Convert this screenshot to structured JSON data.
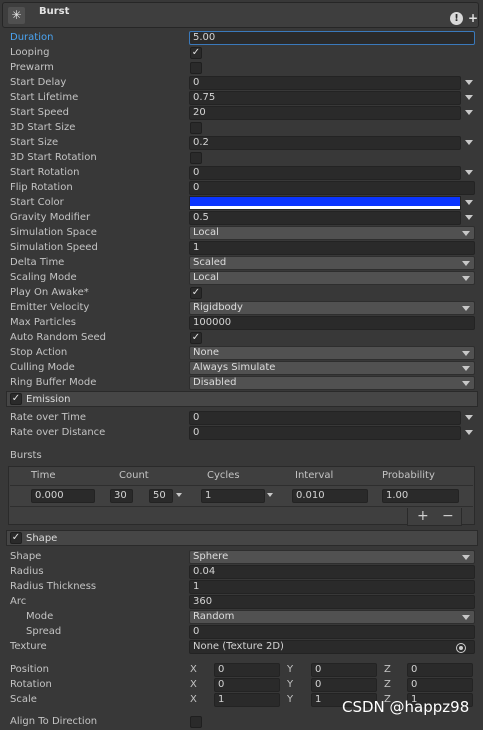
{
  "header": {
    "title": "Burst",
    "icon": "particle-system-icon",
    "help_icon": "help-icon",
    "add_icon": "plus-icon"
  },
  "main": {
    "duration": {
      "label": "Duration",
      "value": "5.00"
    },
    "looping": {
      "label": "Looping",
      "checked": true
    },
    "prewarm": {
      "label": "Prewarm",
      "checked": false
    },
    "start_delay": {
      "label": "Start Delay",
      "value": "0"
    },
    "start_lifetime": {
      "label": "Start Lifetime",
      "value": "0.75"
    },
    "start_speed": {
      "label": "Start Speed",
      "value": "20"
    },
    "start_size_3d": {
      "label": "3D Start Size",
      "checked": false
    },
    "start_size": {
      "label": "Start Size",
      "value": "0.2"
    },
    "start_rotation_3d": {
      "label": "3D Start Rotation",
      "checked": false
    },
    "start_rotation": {
      "label": "Start Rotation",
      "value": "0"
    },
    "flip_rotation": {
      "label": "Flip Rotation",
      "value": "0"
    },
    "start_color": {
      "label": "Start Color",
      "color": "#0b35ff"
    },
    "gravity_modifier": {
      "label": "Gravity Modifier",
      "value": "0.5"
    },
    "simulation_space": {
      "label": "Simulation Space",
      "value": "Local"
    },
    "simulation_speed": {
      "label": "Simulation Speed",
      "value": "1"
    },
    "delta_time": {
      "label": "Delta Time",
      "value": "Scaled"
    },
    "scaling_mode": {
      "label": "Scaling Mode",
      "value": "Local"
    },
    "play_on_awake": {
      "label": "Play On Awake*",
      "checked": true
    },
    "emitter_velocity": {
      "label": "Emitter Velocity",
      "value": "Rigidbody"
    },
    "max_particles": {
      "label": "Max Particles",
      "value": "100000"
    },
    "auto_random_seed": {
      "label": "Auto Random Seed",
      "checked": true
    },
    "stop_action": {
      "label": "Stop Action",
      "value": "None"
    },
    "culling_mode": {
      "label": "Culling Mode",
      "value": "Always Simulate"
    },
    "ring_buffer_mode": {
      "label": "Ring Buffer Mode",
      "value": "Disabled"
    }
  },
  "emission": {
    "title": "Emission",
    "enabled": true,
    "rate_over_time": {
      "label": "Rate over Time",
      "value": "0"
    },
    "rate_over_distance": {
      "label": "Rate over Distance",
      "value": "0"
    },
    "bursts_label": "Bursts",
    "bursts_headers": [
      "Time",
      "Count",
      "Cycles",
      "Interval",
      "Probability"
    ],
    "burst_row": {
      "time": "0.000",
      "count_min": "30",
      "count_max": "50",
      "cycles": "1",
      "interval": "0.010",
      "probability": "1.00"
    },
    "add_label": "+",
    "remove_label": "−"
  },
  "shape": {
    "title": "Shape",
    "enabled": true,
    "shape": {
      "label": "Shape",
      "value": "Sphere"
    },
    "radius": {
      "label": "Radius",
      "value": "0.04"
    },
    "radius_thickness": {
      "label": "Radius Thickness",
      "value": "1"
    },
    "arc": {
      "label": "Arc",
      "value": "360"
    },
    "mode": {
      "label": "Mode",
      "value": "Random"
    },
    "spread": {
      "label": "Spread",
      "value": "0"
    },
    "texture": {
      "label": "Texture",
      "value": "None (Texture 2D)"
    },
    "axis": {
      "x": "X",
      "y": "Y",
      "z": "Z"
    },
    "position": {
      "label": "Position",
      "x": "0",
      "y": "0",
      "z": "0"
    },
    "rotation": {
      "label": "Rotation",
      "x": "0",
      "y": "0",
      "z": "0"
    },
    "scale": {
      "label": "Scale",
      "x": "1",
      "y": "1",
      "z": "1"
    },
    "align_to_direction": {
      "label": "Align To Direction",
      "checked": false
    }
  },
  "watermark": "CSDN @happz98"
}
